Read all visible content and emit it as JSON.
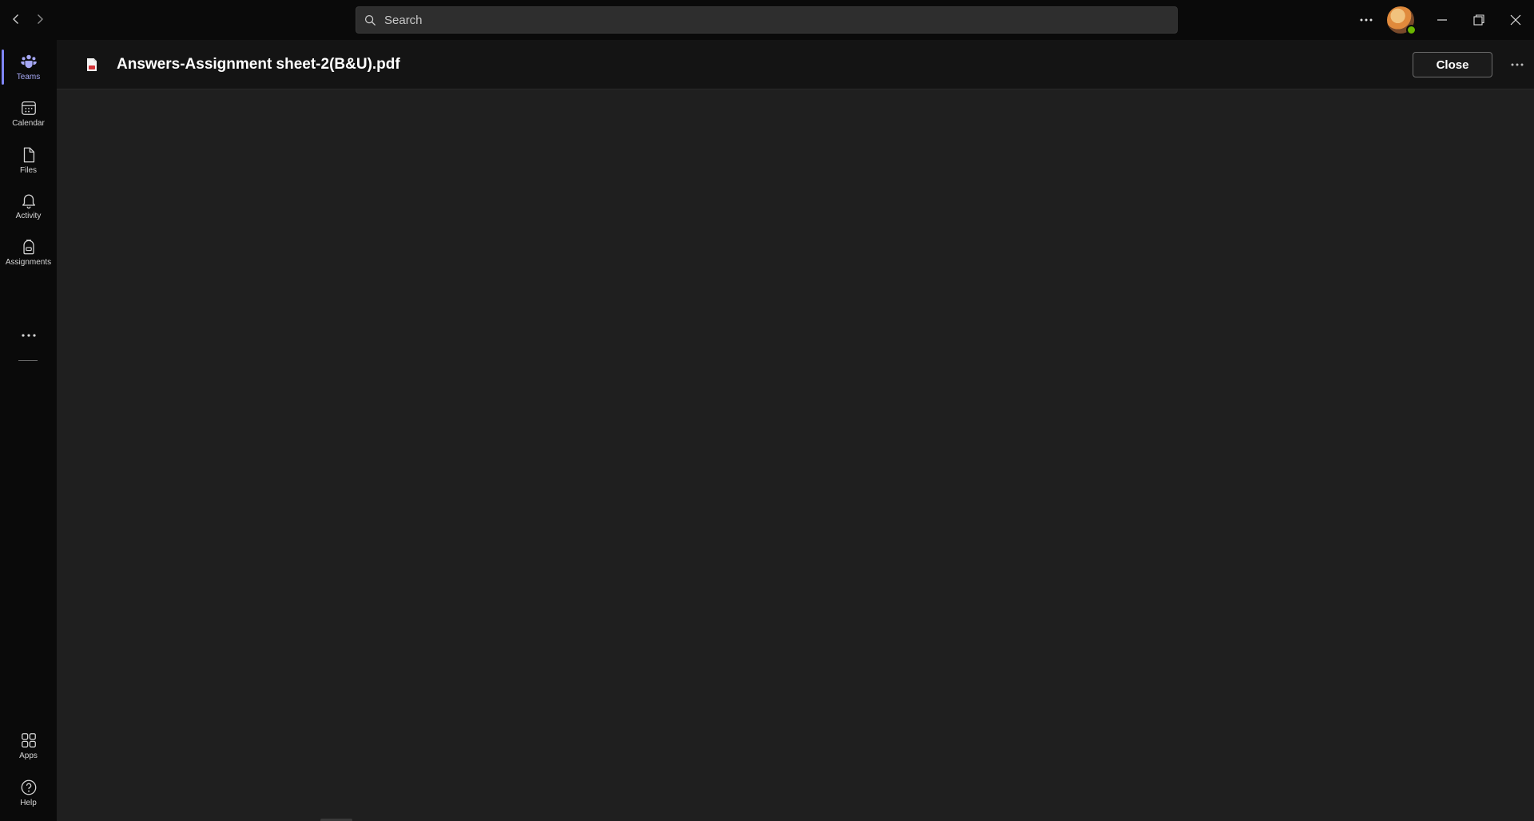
{
  "titlebar": {
    "search_placeholder": "Search",
    "back_icon": "chevron-left-icon",
    "forward_icon": "chevron-right-icon",
    "more_icon": "more-horizontal-icon",
    "window_controls": [
      "minimize-icon",
      "restore-icon",
      "close-icon"
    ],
    "presence_color": "#6bb700"
  },
  "rail": {
    "accent_color": "#7f85f5",
    "items": [
      {
        "label": "Teams",
        "icon": "teams-icon",
        "active": true
      },
      {
        "label": "Calendar",
        "icon": "calendar-icon",
        "active": false
      },
      {
        "label": "Files",
        "icon": "file-icon",
        "active": false
      },
      {
        "label": "Activity",
        "icon": "bell-icon",
        "active": false
      },
      {
        "label": "Assignments",
        "icon": "backpack-icon",
        "active": false
      }
    ],
    "more_icon": "more-horizontal-icon",
    "bottom_items": [
      {
        "label": "Apps",
        "icon": "apps-grid-icon"
      },
      {
        "label": "Help",
        "icon": "help-icon"
      }
    ]
  },
  "file_viewer": {
    "file_icon": "pdf-file-icon",
    "file_name": "Answers-Assignment sheet-2(B&U).pdf",
    "close_label": "Close",
    "more_icon": "more-horizontal-icon"
  }
}
